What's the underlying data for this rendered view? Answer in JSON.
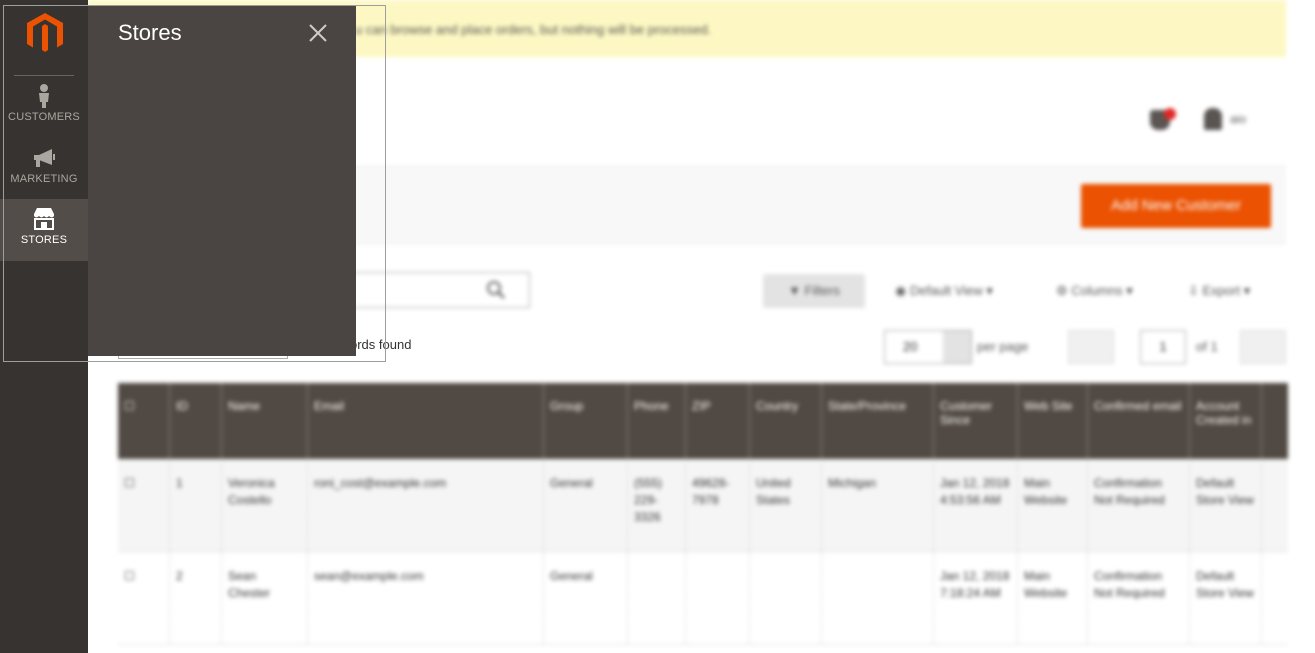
{
  "sidebar": {
    "logo_icon": "magento-logo-icon",
    "items": [
      {
        "label": "CUSTOMERS",
        "icon": "customer-icon",
        "active": false
      },
      {
        "label": "MARKETING",
        "icon": "megaphone-icon",
        "active": false
      },
      {
        "label": "STORES",
        "icon": "store-icon",
        "active": true
      }
    ]
  },
  "flyout": {
    "title": "Stores",
    "close_icon": "close-icon"
  },
  "background": {
    "notice_text": "u can browse and place orders, but nothing will be processed.",
    "user_name": "aio",
    "add_button": "Add New Customer",
    "filters_button": "Filters",
    "default_view": "Default View",
    "columns": "Columns",
    "export": "Export",
    "records_found": "ords found",
    "per_page_value": "20",
    "per_page_label": "per page",
    "page_number": "1",
    "page_of": "of 1"
  },
  "grid": {
    "headers": [
      "ID",
      "Name",
      "Email",
      "Group",
      "Phone",
      "ZIP",
      "Country",
      "State/Province",
      "Customer Since",
      "Web Site",
      "Confirmed email",
      "Account Created in"
    ],
    "rows": [
      {
        "id": "1",
        "name": "Veronica Costello",
        "email": "roni_cost@example.com",
        "group": "General",
        "phone": "(555) 229-3326",
        "zip": "49628-7978",
        "country": "United States",
        "state": "Michigan",
        "since": "Jan 12, 2018 4:53:56 AM",
        "website": "Main Website",
        "confirmed": "Confirmation Not Required",
        "created_in": "Default Store View"
      },
      {
        "id": "2",
        "name": "Sean Chester",
        "email": "sean@example.com",
        "group": "General",
        "phone": "",
        "zip": "",
        "country": "",
        "state": "",
        "since": "Jan 12, 2018 7:18:24 AM",
        "website": "Main Website",
        "confirmed": "Confirmation Not Required",
        "created_in": "Default Store View"
      }
    ]
  },
  "colors": {
    "sidebar_bg": "#373330",
    "sidebar_active": "#524d49",
    "panel_bg": "#4a4542",
    "accent": "#eb5202",
    "notice_bg": "#fdf8c3",
    "grid_header_bg": "#514943"
  }
}
